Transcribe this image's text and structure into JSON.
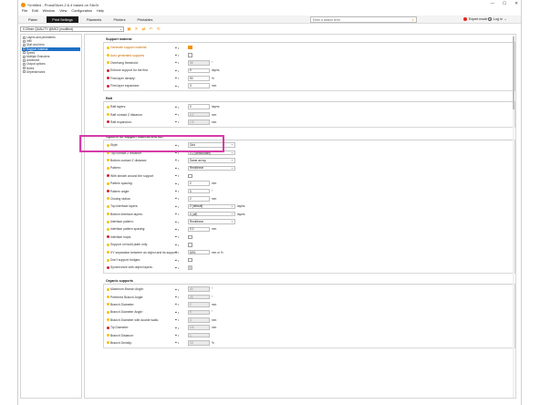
{
  "titlebar": {
    "title": "*Untitled - PrusaSlicer-2.6.4 based on Slic3r",
    "minimize": "—",
    "maximize": "☐",
    "close": "✕"
  },
  "menu": [
    "File",
    "Edit",
    "Window",
    "View",
    "Configuration",
    "Help"
  ],
  "tabs": [
    "Plater",
    "Print Settings",
    "Filaments",
    "Printers",
    "Printables"
  ],
  "search": {
    "placeholder": "Enter a search term"
  },
  "mode": "Expert mode",
  "login": "Log in",
  "preset": "0.20mm QUALITY @MK3 (modified)",
  "nav": [
    "Layers and perimeters",
    "Infill",
    "Skirt and brim",
    "Support material",
    "Speed",
    "Multiple Extruders",
    "Advanced",
    "Output options",
    "Notes",
    "Dependencies"
  ],
  "groups": {
    "support": {
      "title": "Support material",
      "rows": [
        {
          "label": "Generate support material",
          "kind": "check",
          "state": "on",
          "hl": true,
          "bullet": "y"
        },
        {
          "label": "Auto generated supports",
          "kind": "check",
          "state": "off",
          "hl": true,
          "bullet": "y"
        },
        {
          "label": "Overhang threshold:",
          "kind": "field",
          "value": "55",
          "dis": true,
          "unit": "°",
          "bullet": "y"
        },
        {
          "label": "Enforce support for the first",
          "kind": "field",
          "value": "0",
          "unit": "layers",
          "bullet": "r"
        },
        {
          "label": "First layer density:",
          "kind": "field",
          "value": "90",
          "unit": "%",
          "bullet": "r"
        },
        {
          "label": "First layer expansion:",
          "kind": "field",
          "value": "3",
          "unit": "mm",
          "bullet": "r"
        }
      ]
    },
    "raft": {
      "title": "Raft",
      "rows": [
        {
          "label": "Raft layers:",
          "kind": "field",
          "value": "0",
          "unit": "layers",
          "bullet": "y"
        },
        {
          "label": "Raft contact Z distance:",
          "kind": "field",
          "value": "0.2",
          "dis": true,
          "unit": "mm",
          "bullet": "y"
        },
        {
          "label": "Raft expansion:",
          "kind": "field",
          "value": "1.5",
          "dis": true,
          "unit": "mm",
          "bullet": "r"
        }
      ]
    },
    "options": {
      "title": "Options for support material and raft",
      "rows": [
        {
          "label": "Style:",
          "kind": "select",
          "value": "Grid",
          "bullet": "y"
        },
        {
          "label": "Top contact Z distance:",
          "kind": "select",
          "value": "0.2 (detachable)",
          "bullet": "y"
        },
        {
          "label": "Bottom contact Z distance:",
          "kind": "select",
          "value": "Same as top",
          "bullet": "y"
        },
        {
          "label": "Pattern:",
          "kind": "select",
          "value": "Rectilinear",
          "bullet": "y"
        },
        {
          "label": "With sheath around the support",
          "kind": "check",
          "state": "off",
          "bullet": "r"
        },
        {
          "label": "Pattern spacing:",
          "kind": "field",
          "value": "2",
          "unit": "mm",
          "bullet": "y"
        },
        {
          "label": "Pattern angle:",
          "kind": "field",
          "value": "0",
          "unit": "°",
          "bullet": "r"
        },
        {
          "label": "Closing radius:",
          "kind": "field",
          "value": "2",
          "unit": "mm",
          "bullet": "y"
        },
        {
          "label": "Top interface layers:",
          "kind": "select",
          "value": "2 (default)",
          "unit": "layers",
          "bullet": "y"
        },
        {
          "label": "Bottom interface layers:",
          "kind": "select",
          "value": "0 (off)",
          "unit": "layers",
          "bullet": "y"
        },
        {
          "label": "Interface pattern:",
          "kind": "select",
          "value": "Rectilinear",
          "bullet": "y"
        },
        {
          "label": "Interface pattern spacing:",
          "kind": "field",
          "value": "0.2",
          "unit": "mm",
          "bullet": "y"
        },
        {
          "label": "Interface loops:",
          "kind": "check",
          "state": "off",
          "bullet": "r"
        },
        {
          "label": "Support on build plate only:",
          "kind": "check",
          "state": "off",
          "bullet": "y"
        },
        {
          "label": "XY separation between an object and its support:",
          "kind": "field",
          "value": "60%",
          "unit": "mm or %",
          "bullet": "y"
        },
        {
          "label": "Don't support bridges:",
          "kind": "check",
          "state": "off",
          "bullet": "y"
        },
        {
          "label": "Synchronize with object layers:",
          "kind": "check",
          "state": "dis",
          "bullet": "r"
        }
      ]
    },
    "organic": {
      "title": "Organic supports",
      "rows": [
        {
          "label": "Maximum Branch Angle:",
          "kind": "field",
          "value": "40",
          "dis": true,
          "unit": "°",
          "bullet": "y"
        },
        {
          "label": "Preferred Branch Angle:",
          "kind": "field",
          "value": "25",
          "dis": true,
          "unit": "°",
          "bullet": "y"
        },
        {
          "label": "Branch Diameter:",
          "kind": "field",
          "value": "2",
          "dis": true,
          "unit": "mm",
          "bullet": "y"
        },
        {
          "label": "Branch Diameter Angle:",
          "kind": "field",
          "value": "5",
          "dis": true,
          "unit": "°",
          "bullet": "y"
        },
        {
          "label": "Branch Diameter with double walls:",
          "kind": "field",
          "value": "3",
          "dis": true,
          "unit": "mm",
          "bullet": "y"
        },
        {
          "label": "Tip Diameter:",
          "kind": "field",
          "value": "0.8",
          "dis": true,
          "unit": "mm",
          "bullet": "r"
        },
        {
          "label": "Branch Distance:",
          "kind": "field",
          "value": "1",
          "dis": true,
          "bullet": "y"
        },
        {
          "label": "Branch Density:",
          "kind": "field",
          "value": "15",
          "dis": true,
          "unit": "%",
          "bullet": "y"
        }
      ]
    }
  },
  "colors": {
    "accent": "#f39200",
    "selection": "#1f6fc5",
    "highlight_box": "#d63ba7"
  }
}
